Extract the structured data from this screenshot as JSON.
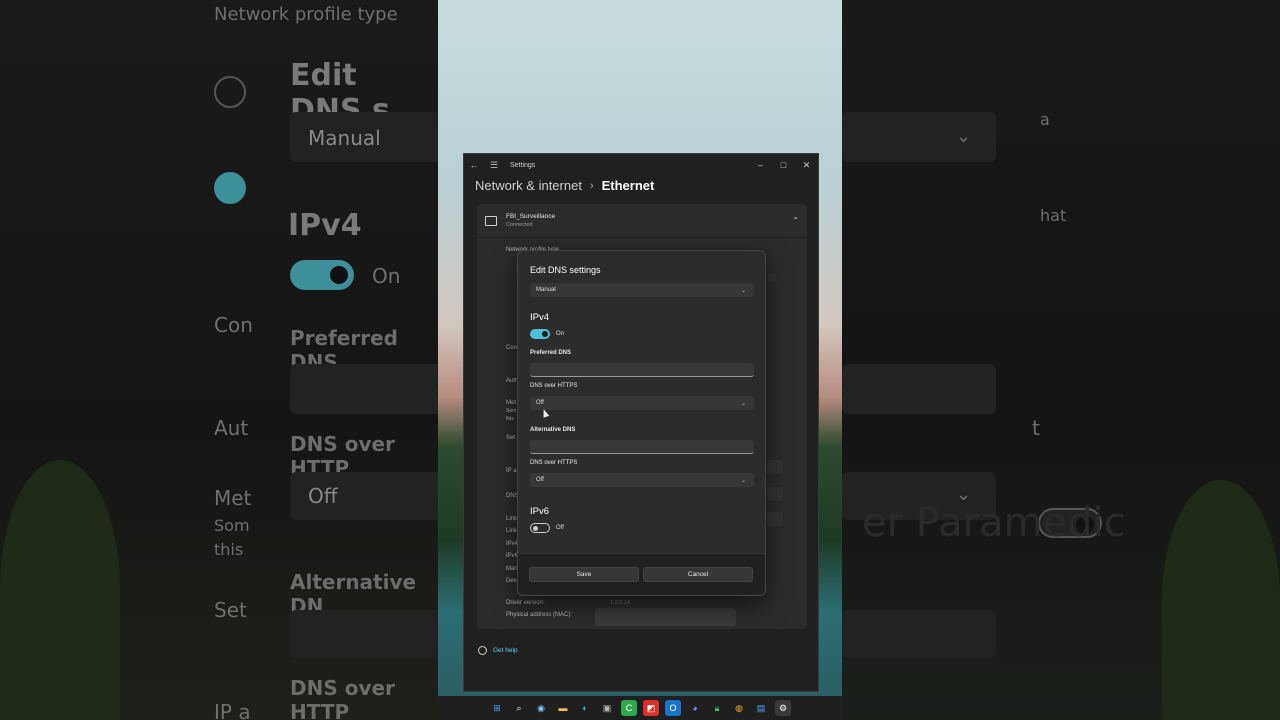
{
  "background_zoom": {
    "left_texts": [
      "Network profile type",
      "Edit DNS s",
      "Manual",
      "IPv4",
      "On",
      "Con",
      "Preferred DNS",
      "Aut",
      "DNS over HTTP",
      "Off",
      "Met",
      "Som",
      "this",
      "Alternative DN",
      "Set",
      "DNS over HTTP",
      "IP a"
    ],
    "right_texts": [
      "a",
      "hat",
      "t",
      "er Paramedic"
    ]
  },
  "window": {
    "title": "Settings",
    "breadcrumb": {
      "parent": "Network & internet",
      "separator": "›",
      "current": "Ethernet"
    },
    "controls": {
      "minimize": "–",
      "maximize": "□",
      "close": "✕"
    }
  },
  "adapter": {
    "name": "FBI_Surveillance",
    "status": "Connected",
    "rows": [
      "Network profile type",
      "Con",
      "Auth",
      "Met",
      "Som",
      "this",
      "Set",
      "IP a",
      "DNS",
      "Link",
      "Link",
      "IPv4",
      "IPv6",
      "Manu",
      "Desc"
    ],
    "driver_label": "Driver version:",
    "driver_value": "1.0.0.14",
    "mac_label": "Physical address (MAC):"
  },
  "help": {
    "label": "Get help"
  },
  "dialog": {
    "title": "Edit DNS settings",
    "mode": "Manual",
    "ipv4": {
      "heading": "IPv4",
      "toggle_label": "On",
      "preferred_label": "Preferred DNS",
      "preferred_value": "",
      "doh_label_1": "DNS over HTTPS",
      "doh_value_1": "Off",
      "alternative_label": "Alternative DNS",
      "alternative_value": "",
      "doh_label_2": "DNS over HTTPS",
      "doh_value_2": "Off"
    },
    "ipv6": {
      "heading": "IPv6",
      "toggle_label": "Off"
    },
    "save_label": "Save",
    "cancel_label": "Cancel"
  },
  "taskbar": {
    "icons": [
      "start-icon",
      "search-icon",
      "widgets-icon",
      "file-explorer-icon",
      "edge-icon",
      "store-icon",
      "camtasia-icon",
      "app-red-icon",
      "outlook-icon",
      "discord-icon",
      "lock-app-icon",
      "chrome-icon",
      "notepad-icon",
      "settings-icon"
    ]
  },
  "colors": {
    "accent": "#4cc2d6",
    "link": "#60cdff",
    "window_bg": "#202020",
    "dialog_bg": "#2c2c2c"
  }
}
